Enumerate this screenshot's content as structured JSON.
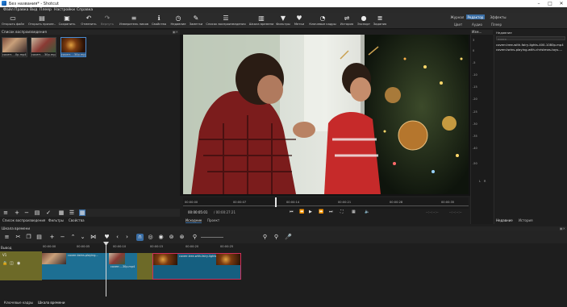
{
  "window": {
    "title": "Без названия* - Shotcut",
    "minimize": "–",
    "maximize": "□",
    "close": "✕"
  },
  "menu": [
    "Файл",
    "Правка",
    "Вид",
    "Плеер",
    "Настройки",
    "Справка"
  ],
  "toolbar": {
    "buttons": [
      {
        "label": "Открыть файл",
        "icon": "folder-icon"
      },
      {
        "label": "Открыть прочее..",
        "icon": "open-other-icon"
      },
      {
        "label": "Сохранить",
        "icon": "save-icon"
      },
      {
        "label": "Отменить",
        "icon": "undo-icon"
      },
      {
        "label": "Вернуть",
        "icon": "redo-icon"
      },
      {
        "label": "Измеритель пиков",
        "icon": "peak-meter-icon"
      },
      {
        "label": "Свойства",
        "icon": "info-icon"
      },
      {
        "label": "Недавние",
        "icon": "clock-icon"
      },
      {
        "label": "Заметки",
        "icon": "notes-icon"
      },
      {
        "label": "Список воспроизведения",
        "icon": "playlist-icon"
      },
      {
        "label": "Шкала времени",
        "icon": "timeline-icon"
      },
      {
        "label": "Фильтры",
        "icon": "filter-icon"
      },
      {
        "label": "Метки",
        "icon": "marker-icon"
      },
      {
        "label": "Ключевые кадры",
        "icon": "keyframes-icon"
      },
      {
        "label": "История",
        "icon": "history-icon"
      },
      {
        "label": "Экспорт",
        "icon": "export-icon"
      },
      {
        "label": "Задания",
        "icon": "jobs-icon"
      }
    ],
    "layouts": [
      "Журнал",
      "Редактор",
      "Эффекты"
    ],
    "active_layout": "Редактор",
    "layouts_sub": [
      "Цвет",
      "Аудио",
      "Плеер"
    ]
  },
  "playlist": {
    "title": "Список воспроизведения",
    "items": [
      {
        "caption": "coverr-...0p.mp4"
      },
      {
        "caption": "coverr-...30p.mp4"
      },
      {
        "caption": "coverr-...30p.mp4"
      }
    ],
    "tabs": [
      "Список воспроизведения",
      "Фильтры",
      "Свойства"
    ]
  },
  "viewer": {
    "ruler": [
      "00:00:00",
      "00:00:07",
      "00:00:14",
      "00:00:21",
      "00:00:28",
      "00:00:35"
    ],
    "timecode": "00:00:05:01",
    "duration": "/ 00:00:27:21",
    "in_point": "--:--:--:--",
    "out_point": "--:--:--:--",
    "tabs": [
      "Исходник",
      "Проект"
    ],
    "active_tab": "Исходник"
  },
  "meter": {
    "ticks": [
      "3",
      "0",
      "-5",
      "-10",
      "-15",
      "-20",
      "-25",
      "-30",
      "-35",
      "-40",
      "-50"
    ],
    "channels": [
      "L",
      "R"
    ],
    "title": "Изм..."
  },
  "recent": {
    "title": "Недавние",
    "search_placeholder": "поиск",
    "items": [
      "coverr-tree-with-fairy-lights-400-1080p.mp4",
      "coverr-twins-playing-with-christmas-toys-..."
    ],
    "tabs": [
      "Недавние",
      "История"
    ],
    "active_tab": "Недавние"
  },
  "timeline": {
    "title": "Шкала времени",
    "output_label": "Вывод",
    "track_label": "V1",
    "ruler": [
      "00:00:00",
      "00:00:05",
      "00:00:10",
      "00:00:15",
      "00:00:20",
      "00:00:25"
    ],
    "clips": [
      {
        "label": "coverr-twins-playing...",
        "color": "#1d6f93"
      },
      {
        "label": "coverr-...30p.mp4",
        "color": "#1d6f93"
      },
      {
        "label": "coverr-tree-with-fairy-lights-400-1080p.mp4",
        "color": "#155f80"
      }
    ],
    "bottom_tabs": [
      "Ключевые кадры",
      "Шкала времени"
    ]
  },
  "colors": {
    "accent": "#3a6ea5",
    "clip_selected_border": "#d0305a",
    "track_header": "#6d6a28"
  }
}
